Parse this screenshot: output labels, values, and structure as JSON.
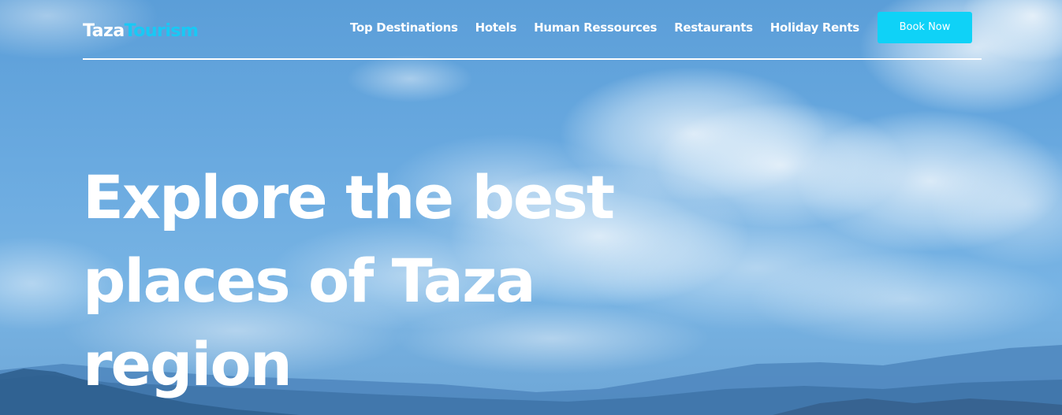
{
  "brand": {
    "part1": "Taza",
    "part2": "Tourism"
  },
  "nav": {
    "items": [
      {
        "label": "Top Destinations"
      },
      {
        "label": "Hotels"
      },
      {
        "label": "Human Ressources"
      },
      {
        "label": "Restaurants"
      },
      {
        "label": "Holiday Rents"
      }
    ],
    "cta_label": "Book Now"
  },
  "hero": {
    "line1": "Explore the best",
    "line2": "places of Taza",
    "line3": "region"
  },
  "colors": {
    "accent": "#0fd2f7",
    "brand_accent": "#18c9f5",
    "sky": "#6aaae0",
    "text": "#ffffff"
  }
}
